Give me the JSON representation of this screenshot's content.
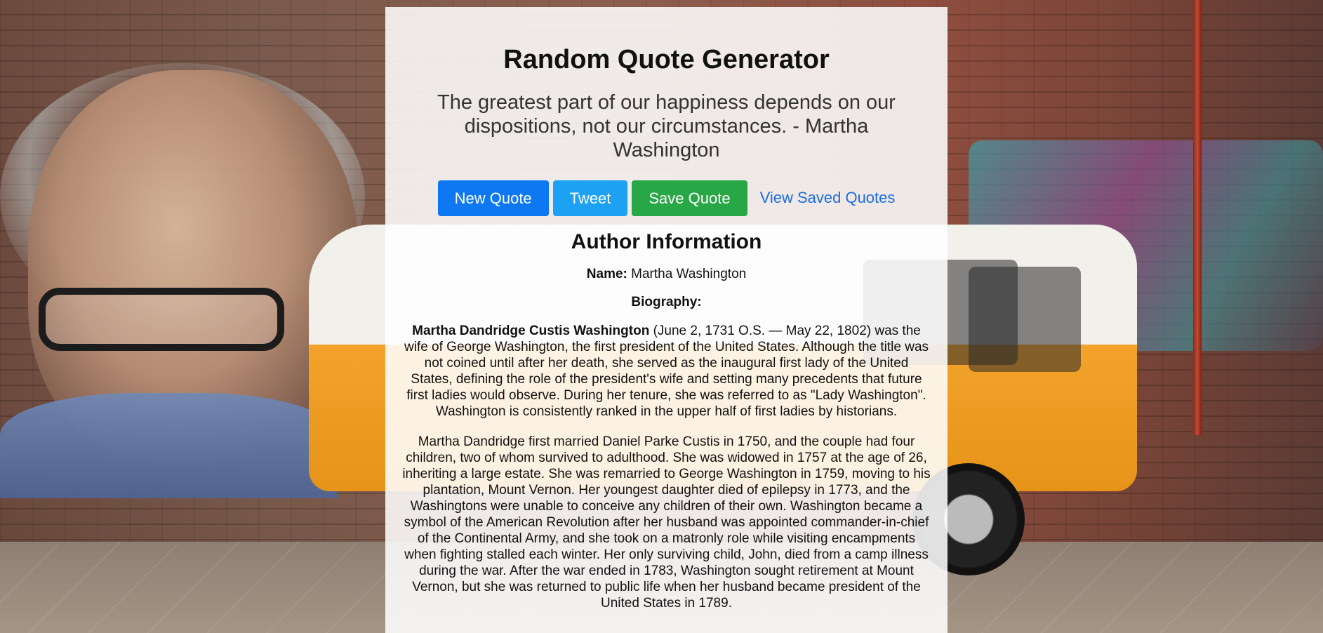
{
  "app": {
    "title": "Random Quote Generator"
  },
  "quote": {
    "text": "The greatest part of our happiness depends on our dispositions, not our circumstances. - Martha Washington"
  },
  "actions": {
    "new_quote_label": "New Quote",
    "tweet_label": "Tweet",
    "save_quote_label": "Save Quote",
    "view_saved_label": "View Saved Quotes"
  },
  "author": {
    "heading": "Author Information",
    "name_label": "Name:",
    "name_value": "Martha Washington",
    "biography_label": "Biography:",
    "bio_bold_name": "Martha Dandridge Custis Washington",
    "bio_paragraph_1_rest": "(June 2, 1731 O.S. — May 22, 1802) was the wife of George Washington, the first president of the United States. Although the title was not coined until after her death, she served as the inaugural first lady of the United States, defining the role of the president's wife and setting many precedents that future first ladies would observe. During her tenure, she was referred to as \"Lady Washington\". Washington is consistently ranked in the upper half of first ladies by historians.",
    "bio_paragraph_2": "Martha Dandridge first married Daniel Parke Custis in 1750, and the couple had four children, two of whom survived to adulthood. She was widowed in 1757 at the age of 26, inheriting a large estate. She was remarried to George Washington in 1759, moving to his plantation, Mount Vernon. Her youngest daughter died of epilepsy in 1773, and the Washingtons were unable to conceive any children of their own. Washington became a symbol of the American Revolution after her husband was appointed commander-in-chief of the Continental Army, and she took on a matronly role while visiting encampments when fighting stalled each winter. Her only surviving child, John, died from a camp illness during the war. After the war ended in 1783, Washington sought retirement at Mount Vernon, but she was returned to public life when her husband became president of the United States in 1789."
  },
  "colors": {
    "new_quote_button": "#0d78f2",
    "tweet_button": "#1da1f2",
    "save_quote_button": "#27a745",
    "link": "#1a6ee0",
    "panel_background": "rgba(255,255,255,0.87)"
  }
}
